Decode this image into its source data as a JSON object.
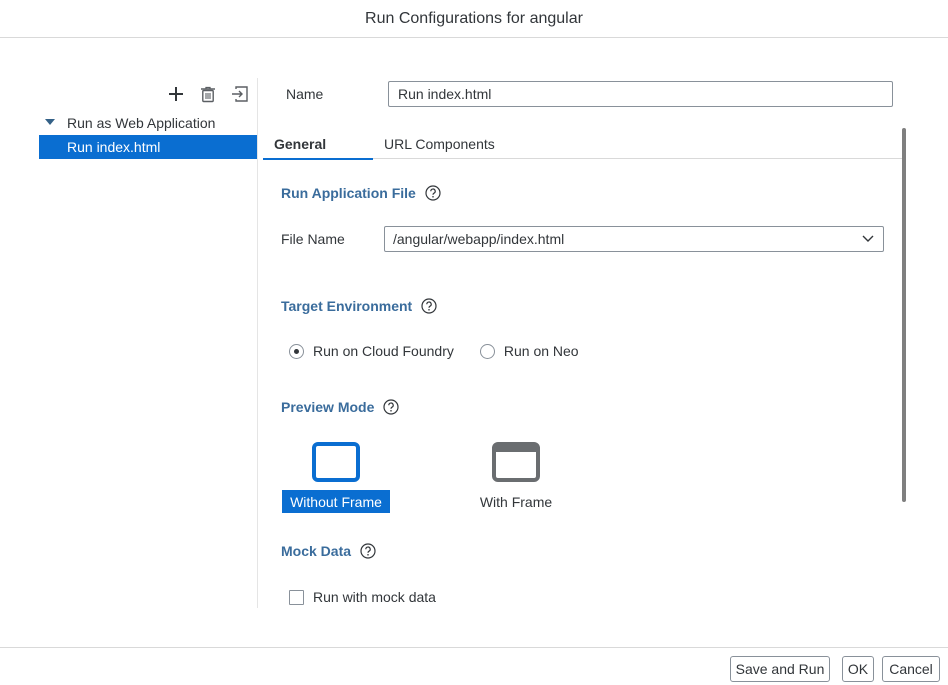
{
  "dialog": {
    "title": "Run Configurations for angular"
  },
  "toolbar": {
    "add_icon": "plus-icon",
    "delete_icon": "trash-icon",
    "import_icon": "import-icon"
  },
  "tree": {
    "root": {
      "label": "Run as Web Application",
      "expanded": true
    },
    "items": [
      {
        "label": "Run index.html",
        "selected": true
      }
    ]
  },
  "config": {
    "name_label": "Name",
    "name_value": "Run index.html"
  },
  "tabs": [
    {
      "label": "General",
      "active": true
    },
    {
      "label": "URL Components",
      "active": false
    }
  ],
  "general": {
    "run_app_file": {
      "title": "Run Application File",
      "file_name_label": "File Name",
      "file_name_value": "/angular/webapp/index.html"
    },
    "target_env": {
      "title": "Target Environment",
      "options": [
        {
          "label": "Run on Cloud Foundry",
          "selected": true
        },
        {
          "label": "Run on Neo",
          "selected": false
        }
      ]
    },
    "preview_mode": {
      "title": "Preview Mode",
      "options": [
        {
          "label": "Without Frame",
          "selected": true
        },
        {
          "label": "With Frame",
          "selected": false
        }
      ]
    },
    "mock_data": {
      "title": "Mock Data",
      "checkbox_label": "Run with mock data",
      "checked": false
    }
  },
  "footer": {
    "save_and_run": "Save and Run",
    "ok": "OK",
    "cancel": "Cancel"
  },
  "colors": {
    "accent": "#0a6ed1",
    "section_title": "#3a6c9c",
    "text": "#32363a"
  }
}
